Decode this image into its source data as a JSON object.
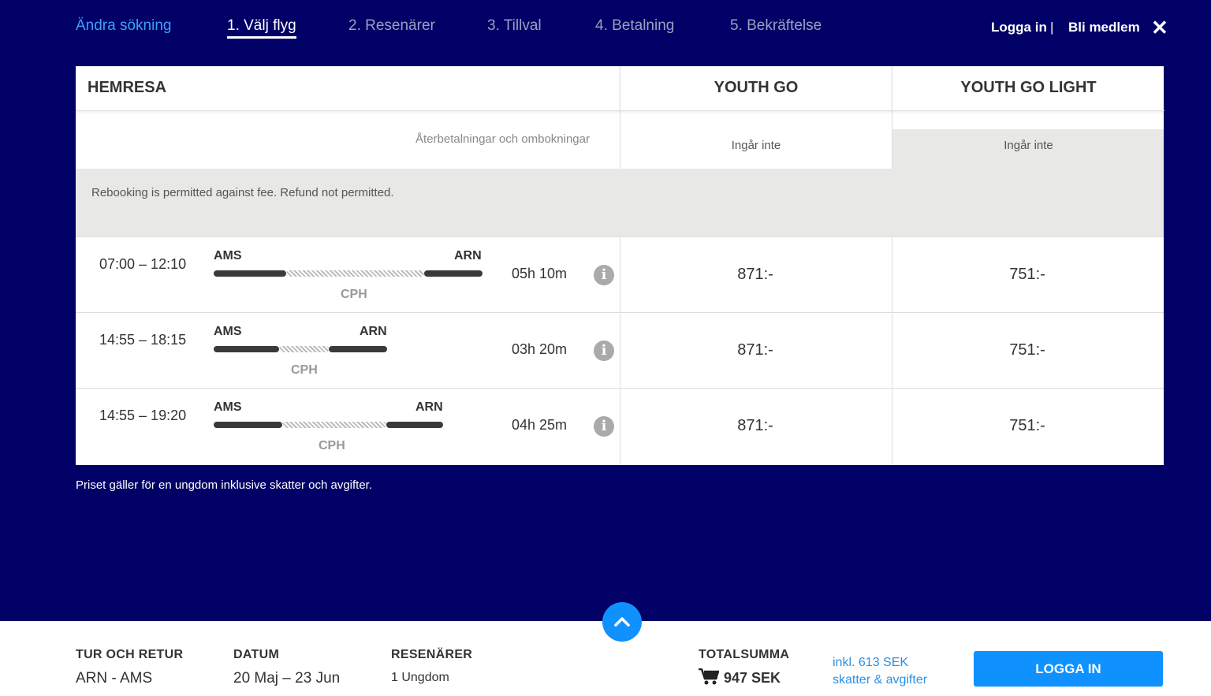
{
  "nav": {
    "change_search": "Ändra sökning",
    "steps": [
      "1. Välj flyg",
      "2. Resenärer",
      "3. Tillval",
      "4. Betalning",
      "5. Bekräftelse"
    ],
    "login": "Logga in",
    "separator": "|",
    "become_member": "Bli medlem"
  },
  "table": {
    "title": "HEMRESA",
    "fares": [
      "YOUTH GO",
      "YOUTH GO LIGHT"
    ],
    "refund_label": "Återbetalningar och ombokningar",
    "refund_values": [
      "Ingår inte",
      "Ingår inte"
    ],
    "refund_note": "Rebooking is permitted against fee. Refund not permitted."
  },
  "flights": [
    {
      "time": "07:00 – 12:10",
      "from": "AMS",
      "to": "ARN",
      "via": "CPH",
      "duration": "05h 10m",
      "prices": [
        "871:-",
        "751:-"
      ]
    },
    {
      "time": "14:55 – 18:15",
      "from": "AMS",
      "to": "ARN",
      "via": "CPH",
      "duration": "03h 20m",
      "prices": [
        "871:-",
        "751:-"
      ]
    },
    {
      "time": "14:55 – 19:20",
      "from": "AMS",
      "to": "ARN",
      "via": "CPH",
      "duration": "04h 25m",
      "prices": [
        "871:-",
        "751:-"
      ]
    }
  ],
  "price_note": "Priset gäller för en ungdom inklusive skatter och avgifter.",
  "footer": {
    "trip_label": "TUR OCH RETUR",
    "trip_value": "ARN - AMS",
    "date_label": "DATUM",
    "date_value": "20 Maj – 23 Jun",
    "travellers_label": "RESENÄRER",
    "travellers_value": "1 Ungdom",
    "total_label": "TOTALSUMMA",
    "total_value": "947 SEK",
    "taxes_line1": "inkl. 613 SEK",
    "taxes_line2": "skatter & avgifter",
    "login_button": "LOGGA IN"
  },
  "icons": {
    "info": "info-icon",
    "cart": "cart-icon",
    "close": "close-icon",
    "chevron_up": "chevron-up-icon"
  }
}
